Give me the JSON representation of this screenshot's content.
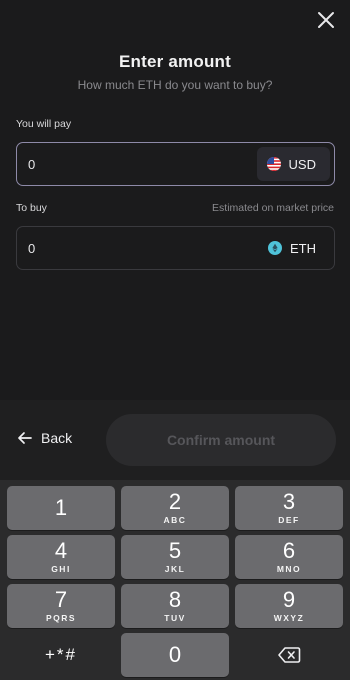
{
  "header": {
    "title": "Enter amount",
    "subtitle": "How much ETH do you want to buy?"
  },
  "pay": {
    "label": "You will pay",
    "value": "0",
    "currency": "USD",
    "currency_icon": "us-flag-icon"
  },
  "buy": {
    "label": "To buy",
    "hint": "Estimated on market price",
    "value": "0",
    "currency": "ETH",
    "currency_icon": "eth-icon",
    "currency_color": "#4fc3d9"
  },
  "actions": {
    "back_label": "Back",
    "back_icon": "arrow-left-icon",
    "confirm_label": "Confirm amount"
  },
  "keypad": {
    "keys": [
      {
        "digit": "1",
        "letters": ""
      },
      {
        "digit": "2",
        "letters": "ABC"
      },
      {
        "digit": "3",
        "letters": "DEF"
      },
      {
        "digit": "4",
        "letters": "GHI"
      },
      {
        "digit": "5",
        "letters": "JKL"
      },
      {
        "digit": "6",
        "letters": "MNO"
      },
      {
        "digit": "7",
        "letters": "PQRS"
      },
      {
        "digit": "8",
        "letters": "TUV"
      },
      {
        "digit": "9",
        "letters": "WXYZ"
      }
    ],
    "symbols_label": "+*#",
    "zero": "0",
    "backspace_icon": "backspace-icon"
  },
  "colors": {
    "background": "#1b1b1c",
    "keypad_background": "#2b2b2c",
    "key": "#6b6b6e",
    "active_border": "#8e8aa8",
    "confirm_disabled_text": "#56565a"
  }
}
